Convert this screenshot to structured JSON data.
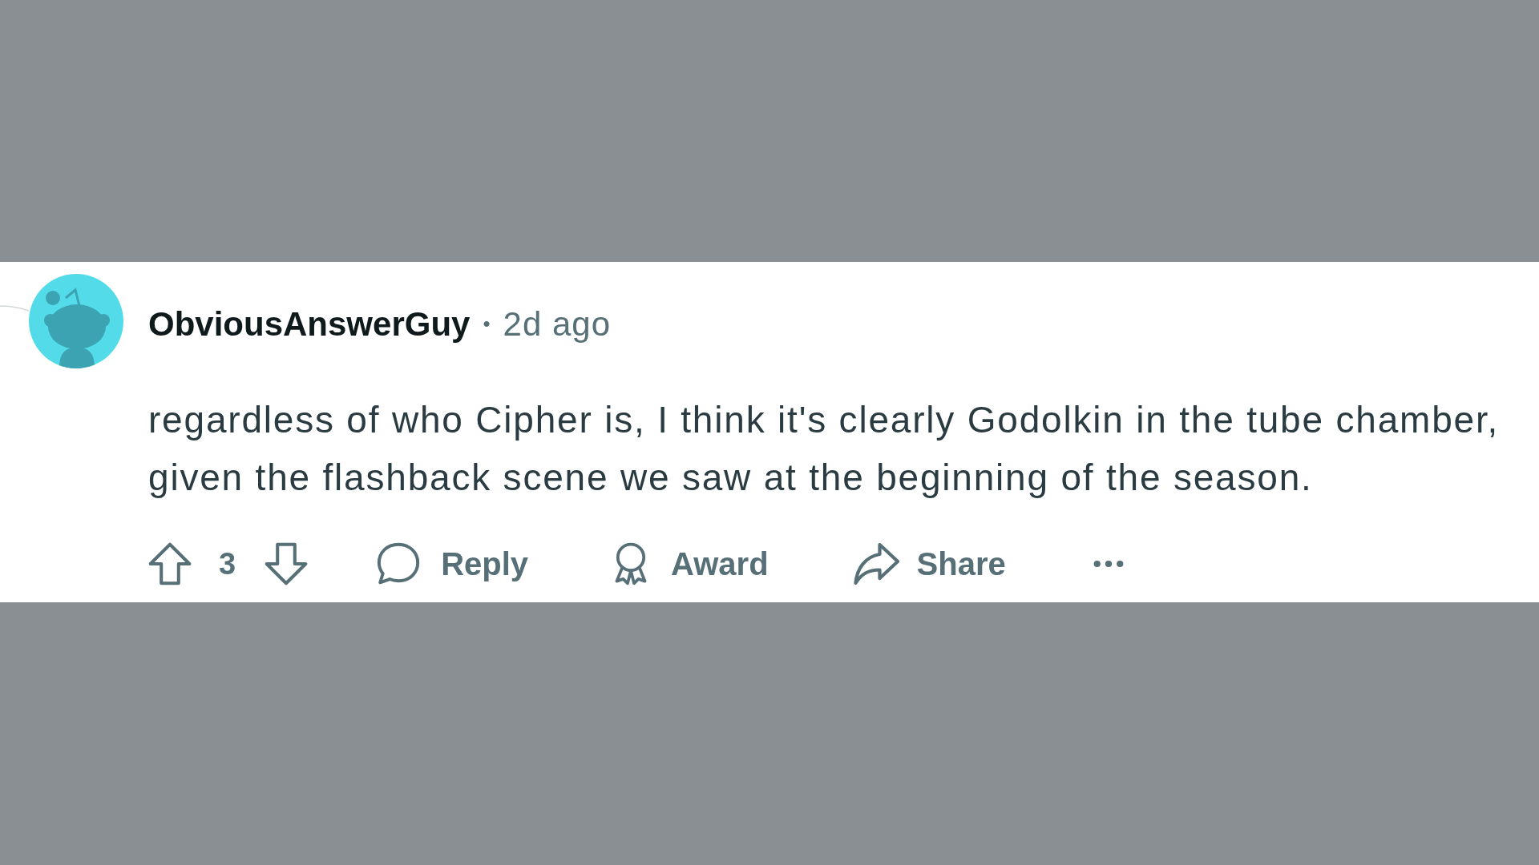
{
  "comment": {
    "author": "ObviousAnswerGuy",
    "separator": "•",
    "time": "2d ago",
    "body": "regardless of who Cipher is, I think it's clearly Godolkin in the tube chamber, given the flashback scene we saw at the beginning of the season.",
    "score": "3",
    "actions": [
      {
        "kind": "reply",
        "label": "Reply"
      },
      {
        "kind": "award",
        "label": "Award"
      },
      {
        "kind": "share",
        "label": "Share"
      },
      {
        "kind": "more"
      }
    ]
  }
}
